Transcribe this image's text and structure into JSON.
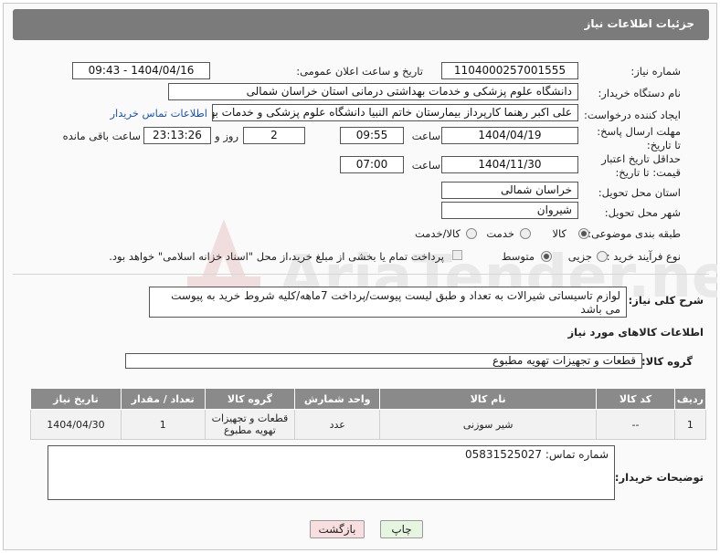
{
  "header": {
    "title": "جزئیات اطلاعات نیاز"
  },
  "form": {
    "need_number_label": "شماره نیاز:",
    "need_number": "1104000257001555",
    "announce_label": "تاریخ و ساعت اعلان عمومی:",
    "announce_value": "1404/04/16 - 09:43",
    "buyer_org_label": "نام دستگاه خریدار:",
    "buyer_org": "دانشگاه علوم پزشکی و خدمات بهداشتی درمانی استان خراسان شمالی",
    "requester_label": "ایجاد کننده درخواست:",
    "requester": "علی اکبر رهنما کارپرداز بیمارستان خاتم النبیا دانشگاه علوم پزشکی و خدمات بهداشتی",
    "buyer_contact_link": "اطلاعات تماس خریدار",
    "deadline_label": "مهلت ارسال پاسخ: تا تاریخ:",
    "deadline_date": "1404/04/19",
    "time_label": "ساعت",
    "deadline_time": "09:55",
    "days_value": "2",
    "days_label": "روز و",
    "remaining_time": "23:13:26",
    "remaining_label": "ساعت باقی مانده",
    "price_validity_label": "حداقل تاریخ اعتبار قیمت: تا تاریخ:",
    "price_validity_date": "1404/11/30",
    "price_validity_time": "07:00",
    "province_label": "استان محل تحویل:",
    "province": "خراسان شمالی",
    "city_label": "شهر محل تحویل:",
    "city": "شیروان",
    "category_label": "طبقه بندی موضوعی:",
    "category_options": [
      "کالا",
      "خدمت",
      "کالا/خدمت"
    ],
    "category_selected": "کالا",
    "process_label": "نوع فرآیند خرید :",
    "process_options": [
      "جزیی",
      "متوسط"
    ],
    "process_selected": "متوسط",
    "payment_note": "پرداخت تمام یا بخشی از مبلغ خرید،از محل \"اسناد خزانه اسلامی\" خواهد بود."
  },
  "description": {
    "label": "شرح کلی نیاز:",
    "text": "لوازم تاسیساتی شیرالات به تعداد و طبق لیست پیوست/پرداخت 7ماهه/کلیه شروط خرید به پیوست می باشد"
  },
  "goods": {
    "section_title": "اطلاعات کالاهای مورد نیاز",
    "group_label": "گروه کالا:",
    "group_value": "قطعات و تجهیزات تهویه مطبوع",
    "table": {
      "headers": [
        "ردیف",
        "کد کالا",
        "نام کالا",
        "واحد شمارش",
        "گروه کالا",
        "تعداد / مقدار",
        "تاریخ نیاز"
      ],
      "rows": [
        [
          "1",
          "--",
          "شیر سوزنی",
          "عدد",
          "قطعات و تجهیزات تهویه مطبوع",
          "1",
          "1404/04/30"
        ]
      ]
    }
  },
  "buyer_notes": {
    "label": "توضیحات خریدار:",
    "text": "شماره تماس: 05831525027"
  },
  "buttons": {
    "print": "چاپ",
    "back": "بازگشت"
  },
  "colors": {
    "header_bg": "#7b7b7b",
    "table_header_bg": "#8a8a8a",
    "link": "#1a56b5",
    "print_btn": "#e6f5e0",
    "back_btn": "#f8dede"
  },
  "watermark_text": "AriaTender.neT"
}
